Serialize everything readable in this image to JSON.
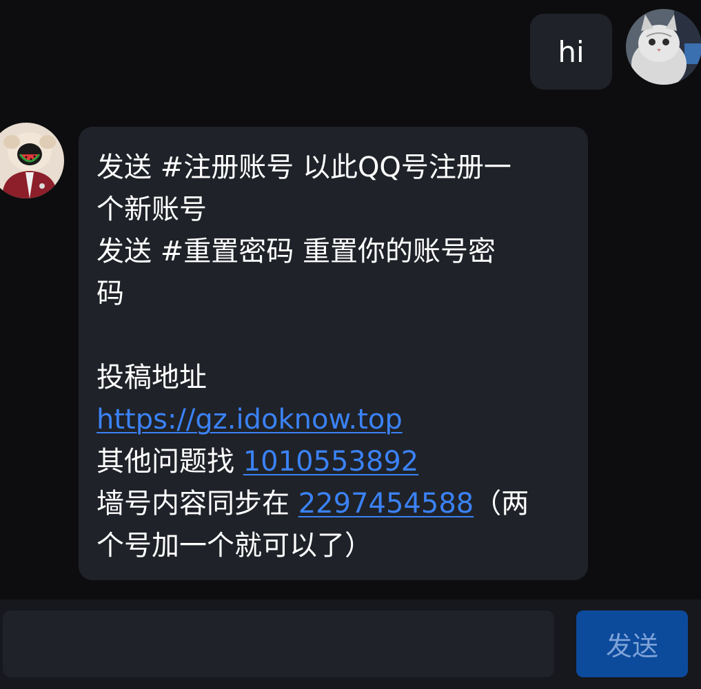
{
  "messages": {
    "self": {
      "text": "hi",
      "avatar_icon": "cat-avatar-icon"
    },
    "bot": {
      "avatar_icon": "watermelon-face-avatar-icon",
      "lines": [
        "发送 #注册账号 以此QQ号注册一",
        "个新账号",
        "发送 #重置密码 重置你的账号密",
        "码",
        "",
        "投稿地址"
      ],
      "url": "https://gz.idoknow.top",
      "other_prefix": "其他问题找 ",
      "other_qq": "1010553892",
      "sync_prefix": "墙号内容同步在 ",
      "sync_qq": "2297454588",
      "sync_suffix": "（两",
      "last_line": "个号加一个就可以了）"
    }
  },
  "composer": {
    "input_value": "",
    "send_label": "发送"
  },
  "colors": {
    "background": "#0d0d0f",
    "bubble": "#1f2228",
    "link": "#3b82f6",
    "send_button": "#0c4a9c"
  }
}
